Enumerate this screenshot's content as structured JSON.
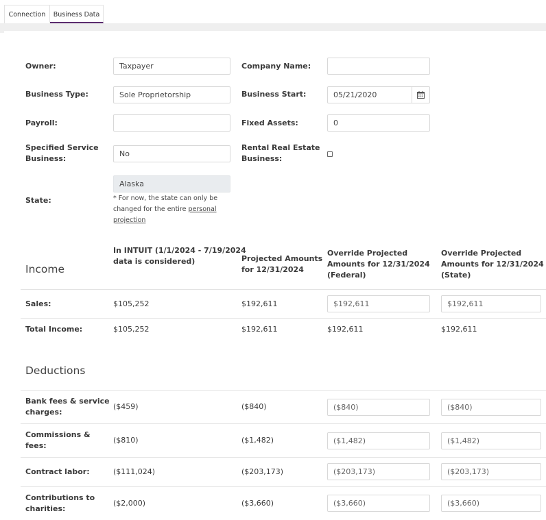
{
  "tabs": [
    {
      "label": "Connection"
    },
    {
      "label": "Business Data"
    }
  ],
  "form": {
    "owner_label": "Owner:",
    "owner_value": "Taxpayer",
    "company_name_label": "Company Name:",
    "company_name_value": "",
    "business_type_label": "Business Type:",
    "business_type_value": "Sole Proprietorship",
    "business_start_label": "Business Start:",
    "business_start_value": "05/21/2020",
    "payroll_label": "Payroll:",
    "payroll_value": "",
    "fixed_assets_label": "Fixed Assets:",
    "fixed_assets_value": "0",
    "ssb_label_1": "Specified Service",
    "ssb_label_2": "Business:",
    "ssb_value": "No",
    "rre_label_1": "Rental Real Estate",
    "rre_label_2": "Business:",
    "rre_checked": false,
    "state_label": "State:",
    "state_value": "Alaska",
    "state_note_1": "* For now, the state can only be",
    "state_note_2": "changed for the entire",
    "state_note_link_1": "personal",
    "state_note_link_2": "projection"
  },
  "columns": {
    "intuit_1": "In INTUIT (1/1/2024 - 7/19/2024",
    "intuit_2": "data is considered)",
    "projected_1": "Projected Amounts",
    "projected_2": "for 12/31/2024",
    "fed_1": "Override Projected",
    "fed_2": "Amounts for 12/31/2024",
    "fed_3": "(Federal)",
    "state_1": "Override Projected",
    "state_2": "Amounts for 12/31/2024",
    "state_3": "(State)"
  },
  "income": {
    "title": "Income",
    "rows": [
      {
        "label": "Sales:",
        "intuit": "$105,252",
        "projected": "$192,611",
        "federal": "$192,611",
        "state": "$192,611"
      }
    ],
    "total": {
      "label": "Total Income:",
      "intuit": "$105,252",
      "projected": "$192,611",
      "federal": "$192,611",
      "state": "$192,611"
    }
  },
  "deductions": {
    "title": "Deductions",
    "rows": [
      {
        "label_1": "Bank fees & service",
        "label_2": "charges:",
        "intuit": "($459)",
        "projected": "($840)",
        "federal": "($840)",
        "state": "($840)"
      },
      {
        "label_1": "Commissions &",
        "label_2": "fees:",
        "intuit": "($810)",
        "projected": "($1,482)",
        "federal": "($1,482)",
        "state": "($1,482)"
      },
      {
        "label_1": "Contract labor:",
        "label_2": "",
        "intuit": "($111,024)",
        "projected": "($203,173)",
        "federal": "($203,173)",
        "state": "($203,173)"
      },
      {
        "label_1": "Contributions to",
        "label_2": "charities:",
        "intuit": "($2,000)",
        "projected": "($3,660)",
        "federal": "($3,660)",
        "state": "($3,660)"
      }
    ]
  },
  "icons": {
    "calendar": "calendar-icon",
    "checkbox": "checkbox"
  },
  "colors": {
    "tab_active_underline": "#5b2c6f",
    "disabled_input_bg": "#e9ecef"
  }
}
